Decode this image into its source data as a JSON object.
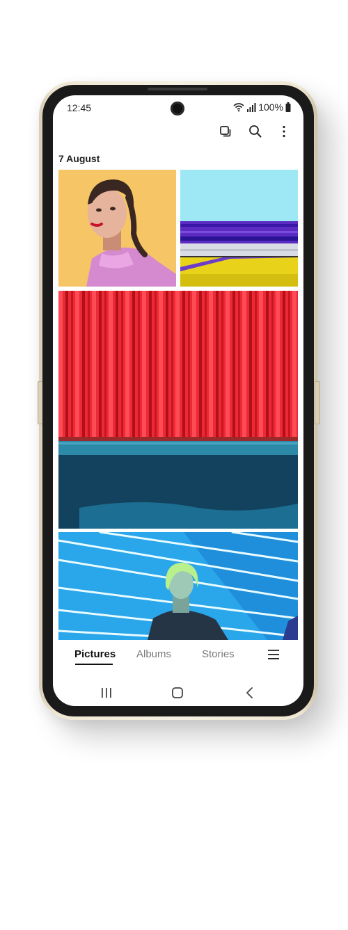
{
  "status": {
    "time": "12:45",
    "battery": "100%"
  },
  "gallery": {
    "date_header": "7 August",
    "photos": [
      {
        "subject": "woman-with-braids-yellow-background"
      },
      {
        "subject": "cyan-purple-yellow-stripes"
      },
      {
        "subject": "red-corrugated-wall-blue-ledge"
      },
      {
        "subject": "woman-blue-light-stripes"
      }
    ]
  },
  "tabs": {
    "pictures": "Pictures",
    "albums": "Albums",
    "stories": "Stories",
    "active": "pictures"
  },
  "icons": {
    "select": "select-icon",
    "search": "search-icon",
    "more": "more-vertical-icon",
    "menu": "hamburger-menu-icon",
    "recents": "recents-icon",
    "home": "home-icon",
    "back": "back-icon"
  },
  "colors": {
    "frame": "#efe7d3",
    "text": "#222222",
    "inactive_tab": "#7a7a7a"
  }
}
